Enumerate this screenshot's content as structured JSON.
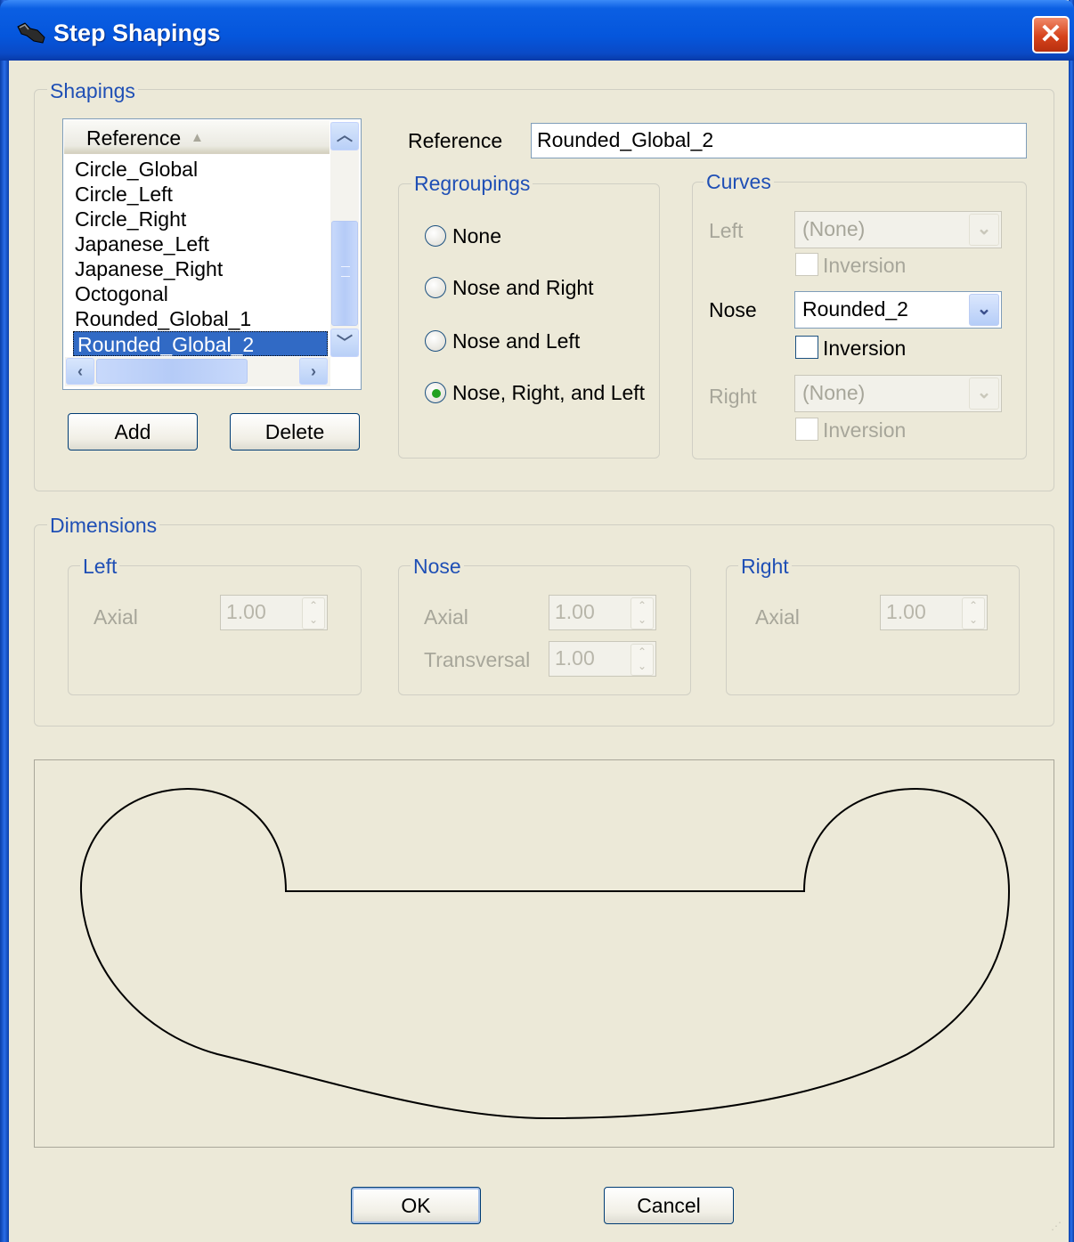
{
  "window": {
    "title": "Step Shapings",
    "close_label": "✕",
    "icon": "boot-app-icon"
  },
  "shapings": {
    "group_label": "Shapings",
    "list": {
      "column_header": "Reference",
      "sort_indicator": "▲",
      "items": [
        "Circle_Global",
        "Circle_Left",
        "Circle_Right",
        "Japanese_Left",
        "Japanese_Right",
        "Octogonal",
        "Rounded_Global_1",
        "Rounded_Global_2"
      ],
      "selected_index": 7
    },
    "add_label": "Add",
    "delete_label": "Delete",
    "reference_label": "Reference",
    "reference_value": "Rounded_Global_2",
    "regroupings": {
      "label": "Regroupings",
      "options": [
        "None",
        "Nose and Right",
        "Nose and Left",
        "Nose, Right, and Left"
      ],
      "selected_index": 3
    },
    "curves": {
      "label": "Curves",
      "left": {
        "label": "Left",
        "value": "(None)",
        "inversion_label": "Inversion",
        "enabled": false
      },
      "nose": {
        "label": "Nose",
        "value": "Rounded_2",
        "inversion_label": "Inversion",
        "enabled": true
      },
      "right": {
        "label": "Right",
        "value": "(None)",
        "inversion_label": "Inversion",
        "enabled": false
      }
    }
  },
  "dimensions": {
    "group_label": "Dimensions",
    "left": {
      "label": "Left",
      "axial_label": "Axial",
      "axial_value": "1.00"
    },
    "nose": {
      "label": "Nose",
      "axial_label": "Axial",
      "axial_value": "1.00",
      "transversal_label": "Transversal",
      "transversal_value": "1.00"
    },
    "right": {
      "label": "Right",
      "axial_label": "Axial",
      "axial_value": "1.00"
    }
  },
  "buttons": {
    "ok_label": "OK",
    "cancel_label": "Cancel"
  },
  "colors": {
    "title_bar": "#0556dc",
    "selection": "#316ac5",
    "group_label": "#1f4fb5",
    "face": "#ece9d8"
  }
}
